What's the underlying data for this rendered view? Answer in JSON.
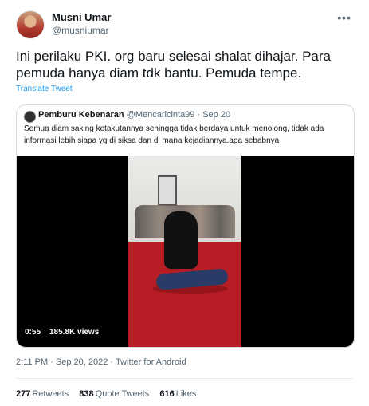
{
  "tweet": {
    "name": "Musni Umar",
    "handle": "@musniumar",
    "more_icon": "ellipsis-icon",
    "text": "Ini perilaku PKI. org baru selesai shalat dihajar. Para pemuda hanya diam tdk bantu. Pemuda tempe.",
    "translate_label": "Translate Tweet"
  },
  "quoted": {
    "name": "Pemburu Kebenaran",
    "handle": "@Mencaricinta99",
    "dot": "·",
    "date": "Sep 20",
    "text": "Semua diam saking ketakutannya sehingga tidak berdaya untuk menolong, tidak ada informasi lebih siapa yg di siksa dan di mana kejadiannya.apa sebabnya",
    "video_time": "0:55",
    "video_views": "185.8K views"
  },
  "meta": {
    "text": "2:11 PM · Sep 20, 2022 · Twitter for Android"
  },
  "stats": {
    "retweets_count": "277",
    "retweets_label": "Retweets",
    "quote_count": "838",
    "quote_label": "Quote Tweets",
    "likes_count": "616",
    "likes_label": "Likes"
  }
}
